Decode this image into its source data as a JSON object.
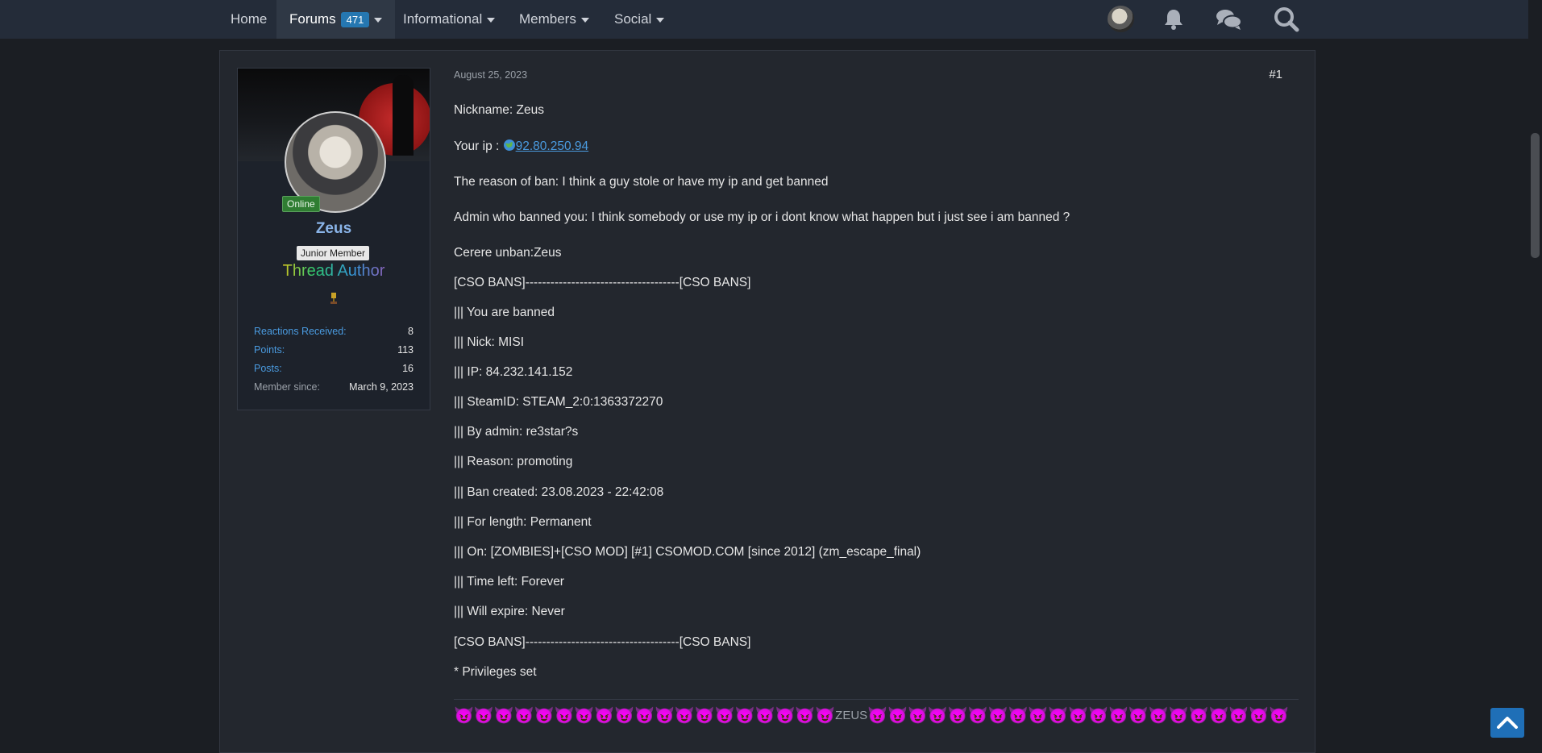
{
  "nav": {
    "items": [
      {
        "label": "Home"
      },
      {
        "label": "Forums",
        "badge": "471"
      },
      {
        "label": "Informational"
      },
      {
        "label": "Members"
      },
      {
        "label": "Social"
      }
    ],
    "icons": [
      "user-avatar-icon",
      "bell-icon",
      "chat-bubbles-icon",
      "search-icon"
    ]
  },
  "user": {
    "status": "Online",
    "name": "Zeus",
    "rank": "Junior Member",
    "role_banner": "Thread Author",
    "stats": [
      {
        "label": "Reactions Received:",
        "value": "8"
      },
      {
        "label": "Points:",
        "value": "113"
      },
      {
        "label": "Posts:",
        "value": "16"
      },
      {
        "label": "Member since:",
        "value": "March 9, 2023"
      }
    ]
  },
  "post": {
    "date": "August 25, 2023",
    "number": "#1",
    "nickname": "Nickname: Zeus",
    "ip_label": "Your ip : ",
    "ip_value": "92.80.250.94",
    "reason": "The reason of ban: I think a guy stole or have my ip and get banned",
    "admin": "Admin who banned you: I think somebody or use my ip or i dont know what happen but i just see i am banned ?",
    "unban": "Cerere unban:Zeus",
    "ban_header": "[CSO BANS]-------------------------------------[CSO BANS]",
    "ban_lines": [
      "||| You are banned",
      "||| Nick: MISI",
      "||| IP: 84.232.141.152",
      "||| SteamID: STEAM_2:0:1363372270",
      "||| By admin: re3star?s",
      "||| Reason: promoting",
      "||| Ban created: 23.08.2023 - 22:42:08",
      "||| For length: Permanent",
      "||| On: [ZOMBIES]+[CSO MOD] [#1] CSOMOD.COM [since 2012] (zm_escape_final)",
      "||| Time left: Forever",
      "||| Will expire: Never"
    ],
    "ban_footer": "[CSO BANS]-------------------------------------[CSO BANS]",
    "privileges": "* Privileges set",
    "signature_text": "ZEUS"
  }
}
